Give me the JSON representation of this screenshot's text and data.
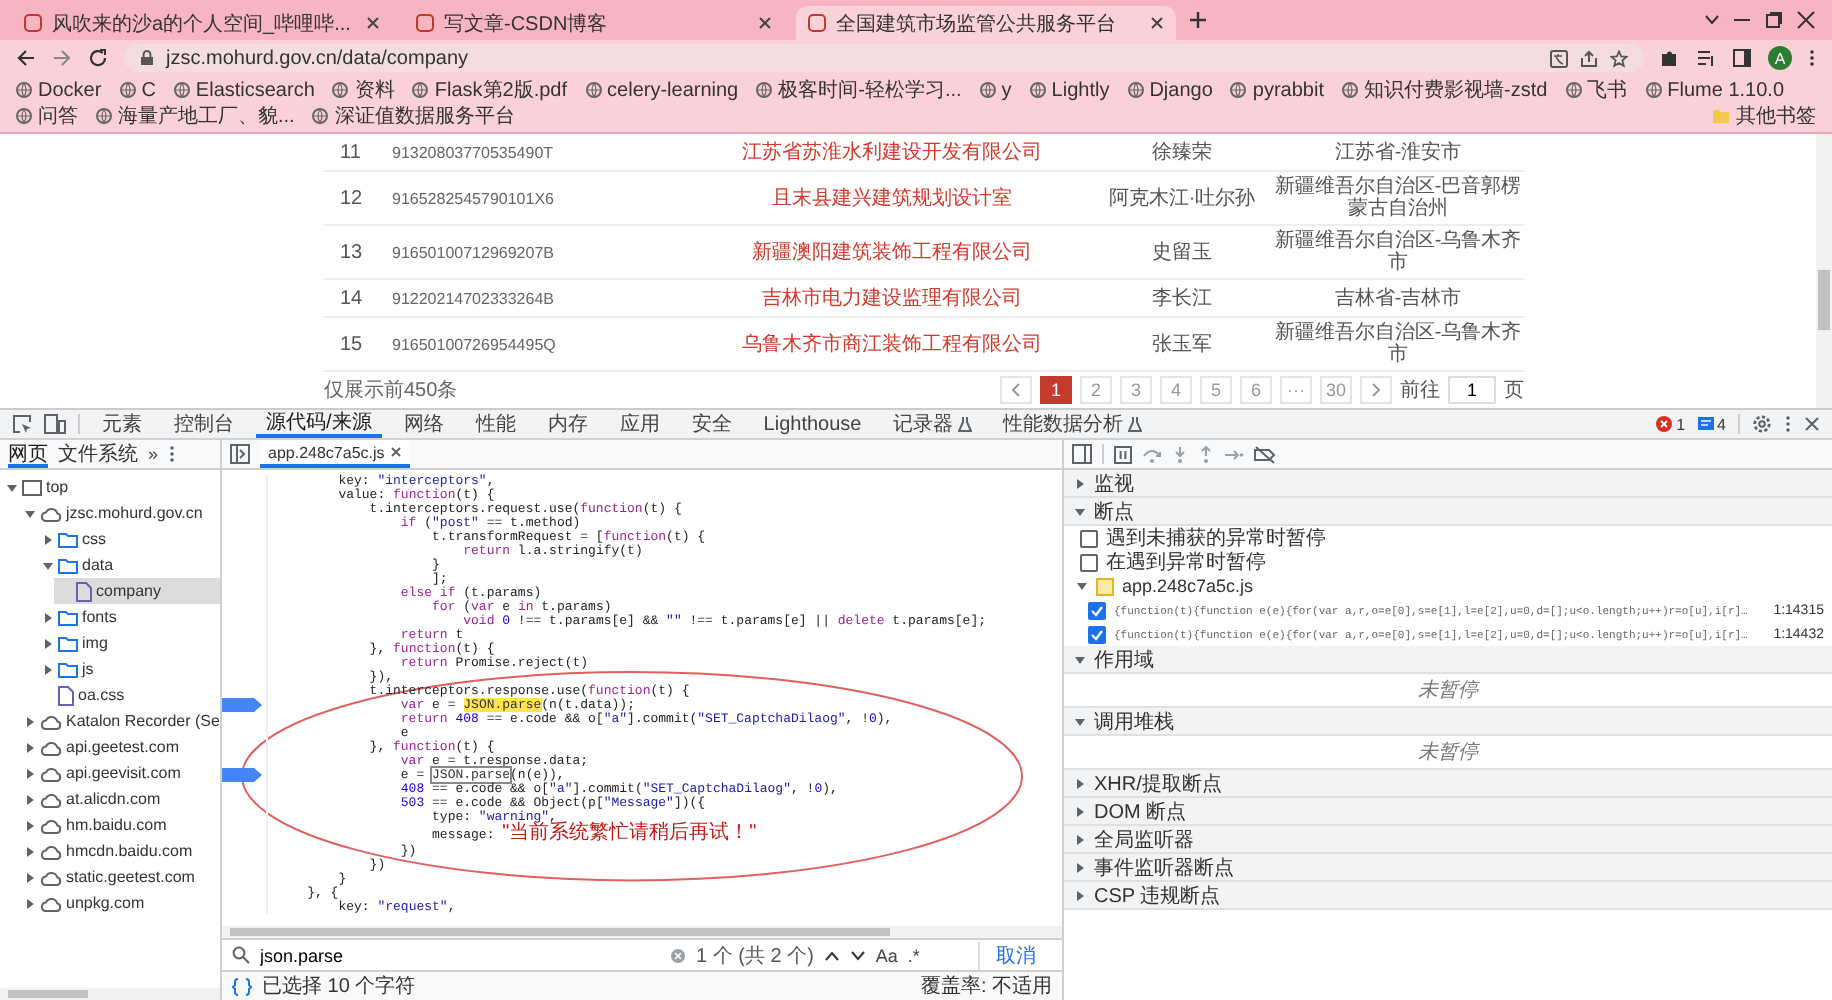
{
  "browser_tabs": [
    {
      "title": "风吹来的沙a的个人空间_哔哩哔...",
      "selected": false
    },
    {
      "title": "写文章-CSDN博客",
      "selected": false
    },
    {
      "title": "全国建筑市场监管公共服务平台",
      "selected": true
    }
  ],
  "address_bar": {
    "url": "jzsc.mohurd.gov.cn/data/company"
  },
  "profile": "A",
  "bookmarks": [
    "Docker",
    "C",
    "Elasticsearch",
    "资料",
    "Flask第2版.pdf",
    "celery-learning",
    "极客时间-轻松学习...",
    "y",
    "Lightly",
    "Django",
    "pyrabbit",
    "知识付费影视墙-zstd",
    "飞书",
    "Flume 1.10.0",
    "问答",
    "海量产地工厂、貌...",
    "深证值数据服务平台"
  ],
  "bookmarks_more": "其他书签",
  "table": {
    "rows": [
      {
        "cells": [
          "11",
          "91320803770535490T",
          "江苏省苏淮水利建设开发有限公司",
          "徐臻荣",
          "江苏省-淮安市"
        ]
      },
      {
        "cells": [
          "12",
          "9165282545790101X6",
          "且末县建兴建筑规划设计室",
          "阿克木江·吐尔孙",
          "新疆维吾尔自治区-巴音郭楞蒙古自治州"
        ]
      },
      {
        "cells": [
          "13",
          "91650100712969207B",
          "新疆澳阳建筑装饰工程有限公司",
          "史留玉",
          "新疆维吾尔自治区-乌鲁木齐市"
        ]
      },
      {
        "cells": [
          "14",
          "91220214702333264B",
          "吉林市电力建设监理有限公司",
          "李长江",
          "吉林省-吉林市"
        ]
      },
      {
        "cells": [
          "15",
          "91650100726954495Q",
          "乌鲁木齐市商江装饰工程有限公司",
          "张玉军",
          "新疆维吾尔自治区-乌鲁木齐市"
        ]
      }
    ]
  },
  "summary": "仅展示前450条",
  "pagination": {
    "pages": [
      {
        "label": "1",
        "selected": true
      },
      {
        "label": "2",
        "selected": false
      },
      {
        "label": "3",
        "selected": false
      },
      {
        "label": "4",
        "selected": false
      },
      {
        "label": "5",
        "selected": false
      },
      {
        "label": "6",
        "selected": false
      },
      {
        "label": "···",
        "selected": false
      },
      {
        "label": "30",
        "selected": false
      }
    ],
    "goto_label": "前往",
    "goto_value": "1",
    "page_suffix": "页"
  },
  "devtools": {
    "tabs": [
      {
        "label": "元素",
        "selected": false,
        "experimental": false
      },
      {
        "label": "控制台",
        "selected": false,
        "experimental": false
      },
      {
        "label": "源代码/来源",
        "selected": true,
        "experimental": false
      },
      {
        "label": "网络",
        "selected": false,
        "experimental": false
      },
      {
        "label": "性能",
        "selected": false,
        "experimental": false
      },
      {
        "label": "内存",
        "selected": false,
        "experimental": false
      },
      {
        "label": "应用",
        "selected": false,
        "experimental": false
      },
      {
        "label": "安全",
        "selected": false,
        "experimental": false
      },
      {
        "label": "Lighthouse",
        "selected": false,
        "experimental": false
      },
      {
        "label": "记录器",
        "selected": false,
        "experimental": true
      },
      {
        "label": "性能数据分析",
        "selected": false,
        "experimental": true
      }
    ],
    "errors": "1",
    "messages": "4",
    "navigator_tabs": [
      {
        "label": "网页",
        "selected": true
      },
      {
        "label": "文件系统",
        "selected": false
      }
    ],
    "navigator_more": "»",
    "tree": [
      {
        "label": "top",
        "kind": "frame",
        "expanded": true,
        "selected": false,
        "children": [
          {
            "label": "jzsc.mohurd.gov.cn",
            "kind": "cloud",
            "expanded": true,
            "selected": false,
            "children": [
              {
                "label": "css",
                "kind": "folder",
                "expanded": false,
                "selected": false
              },
              {
                "label": "data",
                "kind": "folder",
                "expanded": true,
                "selected": false,
                "children": [
                  {
                    "label": "company",
                    "kind": "file",
                    "selected": true
                  }
                ]
              },
              {
                "label": "fonts",
                "kind": "folder",
                "expanded": false,
                "selected": false
              },
              {
                "label": "img",
                "kind": "folder",
                "expanded": false,
                "selected": false
              },
              {
                "label": "js",
                "kind": "folder",
                "expanded": false,
                "selected": false
              },
              {
                "label": "oa.css",
                "kind": "file",
                "selected": false
              }
            ]
          },
          {
            "label": "Katalon Recorder (Se",
            "kind": "cloud",
            "expanded": false,
            "selected": false
          },
          {
            "label": "api.geetest.com",
            "kind": "cloud",
            "expanded": false,
            "selected": false
          },
          {
            "label": "api.geevisit.com",
            "kind": "cloud",
            "expanded": false,
            "selected": false
          },
          {
            "label": "at.alicdn.com",
            "kind": "cloud",
            "expanded": false,
            "selected": false
          },
          {
            "label": "hm.baidu.com",
            "kind": "cloud",
            "expanded": false,
            "selected": false
          },
          {
            "label": "hmcdn.baidu.com",
            "kind": "cloud",
            "expanded": false,
            "selected": false
          },
          {
            "label": "static.geetest.com",
            "kind": "cloud",
            "expanded": false,
            "selected": false
          },
          {
            "label": "unpkg.com",
            "kind": "cloud",
            "expanded": false,
            "selected": false
          }
        ]
      }
    ],
    "file_tab": "app.248c7a5c.js",
    "code": [
      {
        "breakpoint": false,
        "segments": [
          {
            "text": "        key: ",
            "kind": "p"
          },
          {
            "text": "\"interceptors\"",
            "kind": "s"
          },
          {
            "text": ",",
            "kind": "p"
          }
        ]
      },
      {
        "breakpoint": false,
        "segments": [
          {
            "text": "        value: ",
            "kind": "p"
          },
          {
            "text": "function",
            "kind": "k"
          },
          {
            "text": "(t) {",
            "kind": "p"
          }
        ]
      },
      {
        "breakpoint": false,
        "segments": [
          {
            "text": "            t.interceptors.request.use(",
            "kind": "p"
          },
          {
            "text": "function",
            "kind": "k"
          },
          {
            "text": "(t) {",
            "kind": "p"
          }
        ]
      },
      {
        "breakpoint": false,
        "segments": [
          {
            "text": "                if",
            "kind": "k"
          },
          {
            "text": " (",
            "kind": "p"
          },
          {
            "text": "\"post\"",
            "kind": "s"
          },
          {
            "text": " == t.method)",
            "kind": "p"
          }
        ]
      },
      {
        "breakpoint": false,
        "segments": [
          {
            "text": "                    t.transformRequest = [",
            "kind": "p"
          },
          {
            "text": "function",
            "kind": "k"
          },
          {
            "text": "(t) {",
            "kind": "p"
          }
        ]
      },
      {
        "breakpoint": false,
        "segments": [
          {
            "text": "                        return",
            "kind": "k"
          },
          {
            "text": " l.a.stringify(t)",
            "kind": "p"
          }
        ]
      },
      {
        "breakpoint": false,
        "segments": [
          {
            "text": "                    }",
            "kind": "p"
          }
        ]
      },
      {
        "breakpoint": false,
        "segments": [
          {
            "text": "                    ];",
            "kind": "p"
          }
        ]
      },
      {
        "breakpoint": false,
        "segments": [
          {
            "text": "                else if",
            "kind": "k"
          },
          {
            "text": " (t.params)",
            "kind": "p"
          }
        ]
      },
      {
        "breakpoint": false,
        "segments": [
          {
            "text": "                    for",
            "kind": "k"
          },
          {
            "text": " (",
            "kind": "p"
          },
          {
            "text": "var",
            "kind": "k"
          },
          {
            "text": " e ",
            "kind": "p"
          },
          {
            "text": "in",
            "kind": "k"
          },
          {
            "text": " t.params)",
            "kind": "p"
          }
        ]
      },
      {
        "breakpoint": false,
        "segments": [
          {
            "text": "                        void ",
            "kind": "k"
          },
          {
            "text": "0",
            "kind": "n"
          },
          {
            "text": " !== t.params[e] && ",
            "kind": "p"
          },
          {
            "text": "\"\"",
            "kind": "s"
          },
          {
            "text": " !== t.params[e] || ",
            "kind": "p"
          },
          {
            "text": "delete",
            "kind": "k"
          },
          {
            "text": " t.params[e];",
            "kind": "p"
          }
        ]
      },
      {
        "breakpoint": false,
        "segments": [
          {
            "text": "                return",
            "kind": "k"
          },
          {
            "text": " t",
            "kind": "p"
          }
        ]
      },
      {
        "breakpoint": false,
        "segments": [
          {
            "text": "            }, ",
            "kind": "p"
          },
          {
            "text": "function",
            "kind": "k"
          },
          {
            "text": "(t) {",
            "kind": "p"
          }
        ]
      },
      {
        "breakpoint": false,
        "segments": [
          {
            "text": "                return",
            "kind": "k"
          },
          {
            "text": " Promise.reject(t)",
            "kind": "p"
          }
        ]
      },
      {
        "breakpoint": false,
        "segments": [
          {
            "text": "            }),",
            "kind": "p"
          }
        ]
      },
      {
        "breakpoint": false,
        "segments": [
          {
            "text": "            t.interceptors.response.use(",
            "kind": "p"
          },
          {
            "text": "function",
            "kind": "k"
          },
          {
            "text": "(t) {",
            "kind": "p"
          }
        ]
      },
      {
        "breakpoint": true,
        "segments": [
          {
            "text": "                var",
            "kind": "k"
          },
          {
            "text": " e = ",
            "kind": "p"
          },
          {
            "text": "JSON.parse",
            "kind": "m"
          },
          {
            "text": "(n(t.data));",
            "kind": "p"
          }
        ]
      },
      {
        "breakpoint": false,
        "segments": [
          {
            "text": "                return ",
            "kind": "k"
          },
          {
            "text": "408",
            "kind": "n"
          },
          {
            "text": " == e.code && o[",
            "kind": "p"
          },
          {
            "text": "\"a\"",
            "kind": "s"
          },
          {
            "text": "].commit(",
            "kind": "p"
          },
          {
            "text": "\"SET_CaptchaDilaog\"",
            "kind": "s"
          },
          {
            "text": ", !",
            "kind": "p"
          },
          {
            "text": "0",
            "kind": "n"
          },
          {
            "text": "),",
            "kind": "p"
          }
        ]
      },
      {
        "breakpoint": false,
        "segments": [
          {
            "text": "                e",
            "kind": "p"
          }
        ]
      },
      {
        "breakpoint": false,
        "segments": [
          {
            "text": "            }, ",
            "kind": "p"
          },
          {
            "text": "function",
            "kind": "k"
          },
          {
            "text": "(t) {",
            "kind": "p"
          }
        ]
      },
      {
        "breakpoint": false,
        "segments": [
          {
            "text": "                var",
            "kind": "k"
          },
          {
            "text": " e = t.response.data;",
            "kind": "p"
          }
        ]
      },
      {
        "breakpoint": true,
        "segments": [
          {
            "text": "                e = ",
            "kind": "p"
          },
          {
            "text": "JSON.parse",
            "kind": "b"
          },
          {
            "text": "(n(e)),",
            "kind": "p"
          }
        ]
      },
      {
        "breakpoint": false,
        "segments": [
          {
            "text": "                408",
            "kind": "n"
          },
          {
            "text": " == e.code && o[",
            "kind": "p"
          },
          {
            "text": "\"a\"",
            "kind": "s"
          },
          {
            "text": "].commit(",
            "kind": "p"
          },
          {
            "text": "\"SET_CaptchaDilaog\"",
            "kind": "s"
          },
          {
            "text": ", !",
            "kind": "p"
          },
          {
            "text": "0",
            "kind": "n"
          },
          {
            "text": "),",
            "kind": "p"
          }
        ]
      },
      {
        "breakpoint": false,
        "segments": [
          {
            "text": "                503",
            "kind": "n"
          },
          {
            "text": " == e.code && Object(p[",
            "kind": "p"
          },
          {
            "text": "\"Message\"",
            "kind": "s"
          },
          {
            "text": "])({",
            "kind": "p"
          }
        ]
      },
      {
        "breakpoint": false,
        "segments": [
          {
            "text": "                    type: ",
            "kind": "p"
          },
          {
            "text": "\"warning\"",
            "kind": "s"
          },
          {
            "text": ",",
            "kind": "p"
          }
        ]
      },
      {
        "breakpoint": false,
        "segments": [
          {
            "text": "                    message: ",
            "kind": "p"
          },
          {
            "text": "\"当前系统繁忙请稍后再试！\"",
            "kind": "s"
          }
        ]
      },
      {
        "breakpoint": false,
        "segments": [
          {
            "text": "                })",
            "kind": "p"
          }
        ]
      },
      {
        "breakpoint": false,
        "segments": [
          {
            "text": "            })",
            "kind": "p"
          }
        ]
      },
      {
        "breakpoint": false,
        "segments": [
          {
            "text": "        }",
            "kind": "p"
          }
        ]
      },
      {
        "breakpoint": false,
        "segments": [
          {
            "text": "    }, {",
            "kind": "p"
          }
        ]
      },
      {
        "breakpoint": false,
        "segments": [
          {
            "text": "        key: ",
            "kind": "p"
          },
          {
            "text": "\"request\"",
            "kind": "s"
          },
          {
            "text": ",",
            "kind": "p"
          }
        ]
      }
    ],
    "search": {
      "value": "json.parse",
      "result": "1 个 (共 2 个)",
      "case_toggle": "Aa",
      "regex_toggle": ".*",
      "cancel": "取消"
    },
    "status": {
      "selection": "已选择 10 个字符",
      "coverage": "覆盖率: 不适用"
    },
    "debugger": {
      "sections": [
        {
          "title": "监视",
          "expanded": false
        },
        {
          "title": "断点",
          "expanded": true,
          "options": [
            {
              "label": "遇到未捕获的异常时暂停",
              "checked": false
            },
            {
              "label": "在遇到异常时暂停",
              "checked": false
            }
          ],
          "files": [
            {
              "name": "app.248c7a5c.js",
              "expanded": true,
              "breakpoints": [
                {
                  "code": "{function(t){function e(e){for(var a,r,o=e[0],s=e[1],l=e[2],u=0,d=[];u<o.length;u++)r=o[u],i[r]…",
                  "location": "1:14315",
                  "checked": true
                },
                {
                  "code": "{function(t){function e(e){for(var a,r,o=e[0],s=e[1],l=e[2],u=0,d=[];u<o.length;u++)r=o[u],i[r]…",
                  "location": "1:14432",
                  "checked": true
                }
              ]
            }
          ]
        },
        {
          "title": "作用域",
          "expanded": true,
          "message": "未暂停"
        },
        {
          "title": "调用堆栈",
          "expanded": true,
          "message": "未暂停"
        },
        {
          "title": "XHR/提取断点",
          "expanded": false
        },
        {
          "title": "DOM 断点",
          "expanded": false
        },
        {
          "title": "全局监听器",
          "expanded": false
        },
        {
          "title": "事件监听器断点",
          "expanded": false
        },
        {
          "title": "CSP 违规断点",
          "expanded": false
        }
      ]
    }
  }
}
